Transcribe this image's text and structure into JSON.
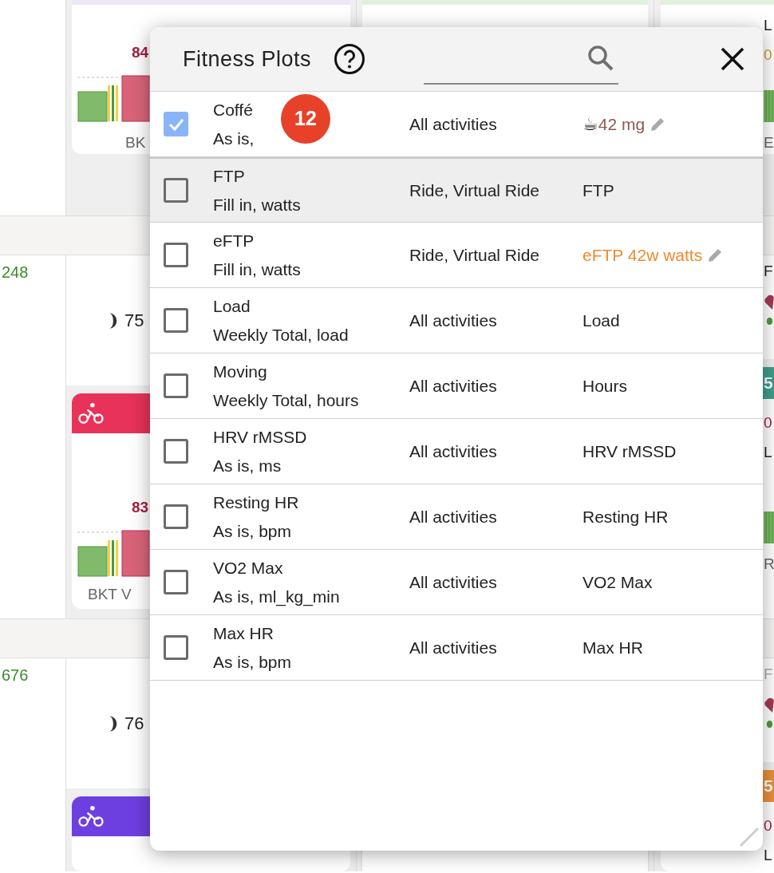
{
  "calendar": {
    "weeks": [
      {
        "left": {
          "activities": [
            {
              "kind": "strip",
              "color": "#ece6f5",
              "lines": [
                {
                  "text": "84",
                  "color": "#a3203f"
                }
              ],
              "chart": {
                "kind": "picture"
              },
              "label": "BK"
            }
          ]
        },
        "middle": {
          "activities": [
            {
              "kind": "strip",
              "color": "#e3f0dc"
            }
          ]
        },
        "right": {
          "activities": [
            {
              "kind": "strip",
              "color": "#e3f0dc",
              "lines": [
                {
                  "text": "L",
                  "color": "#222222"
                },
                {
                  "text": "0",
                  "color": "#c9a227"
                }
              ],
              "chart": {
                "kind": "picture"
              },
              "label": "E"
            }
          ]
        }
      },
      {
        "total": "248",
        "left": {
          "sleep": "75",
          "activities": [
            {
              "kind": "header",
              "color": "#e8325a",
              "lines": [
                {
                  "text": "83",
                  "color": "#a3203f"
                }
              ],
              "chart": {
                "kind": "picture"
              },
              "label": "BKT V"
            }
          ]
        },
        "right": {
          "day_name": "F",
          "muted": false,
          "activities": [
            {
              "kind": "header",
              "color": "#3f9e8a",
              "header_text": "5",
              "lines": [
                {
                  "text": "0",
                  "color": "#a3203f"
                },
                {
                  "text": "L",
                  "color": "#222222"
                }
              ],
              "chart": {
                "kind": "picture"
              },
              "label": "R"
            }
          ]
        }
      },
      {
        "total": "676",
        "left": {
          "sleep": "76",
          "activities": [
            {
              "kind": "header",
              "color": "#6e3fe0"
            }
          ]
        },
        "middle": {
          "activities": [
            {
              "kind": "card"
            }
          ]
        },
        "right": {
          "day_name": "F",
          "muted": true,
          "activities": [
            {
              "kind": "header",
              "color": "#e8903a",
              "header_text": "5",
              "lines": [
                {
                  "text": "0",
                  "color": "#a3203f"
                },
                {
                  "text": "L",
                  "color": "#222222"
                }
              ]
            }
          ]
        }
      }
    ]
  },
  "dialog": {
    "title": "Fitness Plots",
    "rows": [
      {
        "name": "Coffé",
        "detail": "As is,",
        "badge": "12",
        "activities": "All activities",
        "checked": true,
        "selected": false,
        "display": {
          "kind": "custom",
          "icon": "☕",
          "text": "42 mg",
          "color": "#8d5a4e",
          "editable": true
        }
      },
      {
        "name": "FTP",
        "detail": "Fill in, watts",
        "activities": "Ride, Virtual Ride",
        "checked": false,
        "selected": true,
        "display": {
          "kind": "plain",
          "text": "FTP"
        }
      },
      {
        "name": "eFTP",
        "detail": "Fill in, watts",
        "activities": "Ride, Virtual Ride",
        "checked": false,
        "selected": false,
        "display": {
          "kind": "custom",
          "text": "eFTP 42w watts",
          "color": "#ef8a2e",
          "editable": true
        }
      },
      {
        "name": "Load",
        "detail": "Weekly Total, load",
        "activities": "All activities",
        "checked": false,
        "selected": false,
        "display": {
          "kind": "plain",
          "text": "Load"
        }
      },
      {
        "name": "Moving",
        "detail": "Weekly Total, hours",
        "activities": "All activities",
        "checked": false,
        "selected": false,
        "display": {
          "kind": "plain",
          "text": "Hours"
        }
      },
      {
        "name": "HRV rMSSD",
        "detail": "As is, ms",
        "activities": "All activities",
        "checked": false,
        "selected": false,
        "display": {
          "kind": "plain",
          "text": "HRV rMSSD"
        }
      },
      {
        "name": "Resting HR",
        "detail": "As is, bpm",
        "activities": "All activities",
        "checked": false,
        "selected": false,
        "display": {
          "kind": "plain",
          "text": "Resting HR"
        }
      },
      {
        "name": "VO2 Max",
        "detail": "As is, ml_kg_min",
        "activities": "All activities",
        "checked": false,
        "selected": false,
        "display": {
          "kind": "plain",
          "text": "VO2 Max"
        }
      },
      {
        "name": "Max HR",
        "detail": "As is, bpm",
        "activities": "All activities",
        "checked": false,
        "selected": false,
        "display": {
          "kind": "plain",
          "text": "Max HR"
        }
      }
    ]
  }
}
